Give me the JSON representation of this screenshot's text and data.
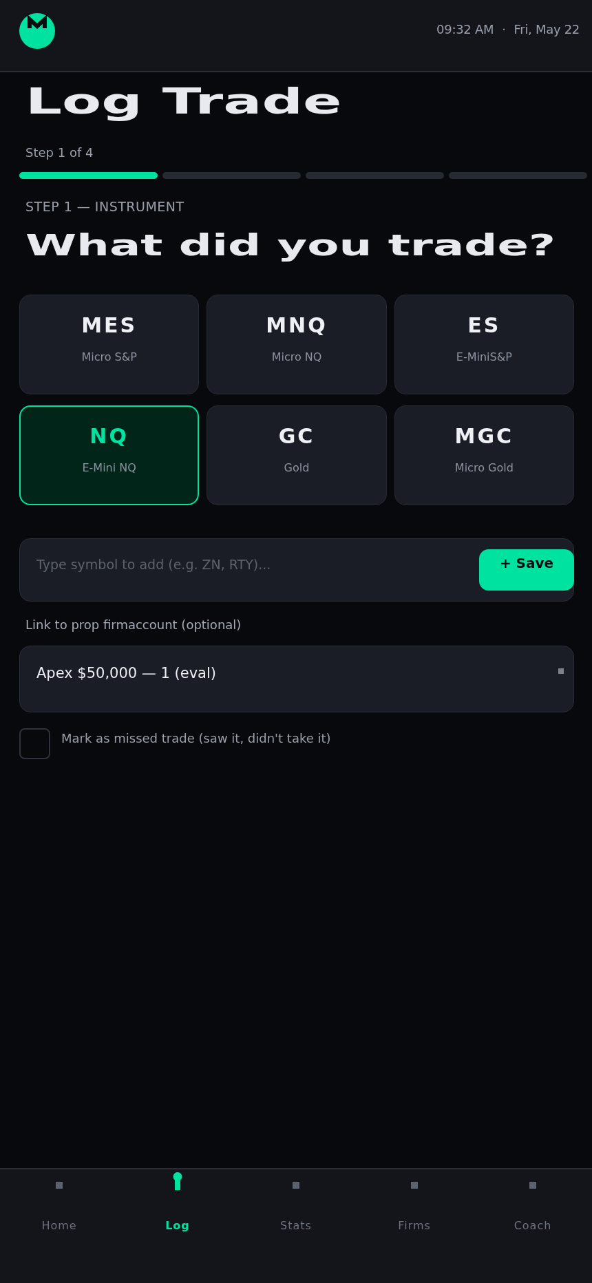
{
  "header": {
    "time": "09:32 AM",
    "separator": "·",
    "date": "Fri, May 22"
  },
  "title": "Log Trade",
  "step_label": "Step 1 of 4",
  "steps": [
    {
      "active": true
    },
    {
      "active": false
    },
    {
      "active": false
    },
    {
      "active": false
    }
  ],
  "section": {
    "eyebrow": "STEP 1 — INSTRUMENT",
    "heading": "What did you trade?"
  },
  "instruments": [
    {
      "symbol": "MES",
      "name": "Micro S&P",
      "selected": false
    },
    {
      "symbol": "MNQ",
      "name": "Micro NQ",
      "selected": false
    },
    {
      "symbol": "ES",
      "name": "E-MiniS&P",
      "selected": false
    },
    {
      "symbol": "NQ",
      "name": "E-Mini NQ",
      "selected": true
    },
    {
      "symbol": "GC",
      "name": "Gold",
      "selected": false
    },
    {
      "symbol": "MGC",
      "name": "Micro Gold",
      "selected": false
    }
  ],
  "symbol_input": {
    "placeholder": "Type symbol to add (e.g. ZN, RTY)...",
    "button": "+ Save"
  },
  "account": {
    "label": "Link to prop firmaccount (optional)",
    "value": "Apex $50,000 — 1 (eval)"
  },
  "missed_trade": {
    "checked": false,
    "label": "Mark as missed trade (saw it, didn't take it)"
  },
  "nav": [
    {
      "label": "Home",
      "selected": false
    },
    {
      "label": "Log",
      "selected": true
    },
    {
      "label": "Stats",
      "selected": false
    },
    {
      "label": "Firms",
      "selected": false
    },
    {
      "label": "Coach",
      "selected": false
    }
  ]
}
